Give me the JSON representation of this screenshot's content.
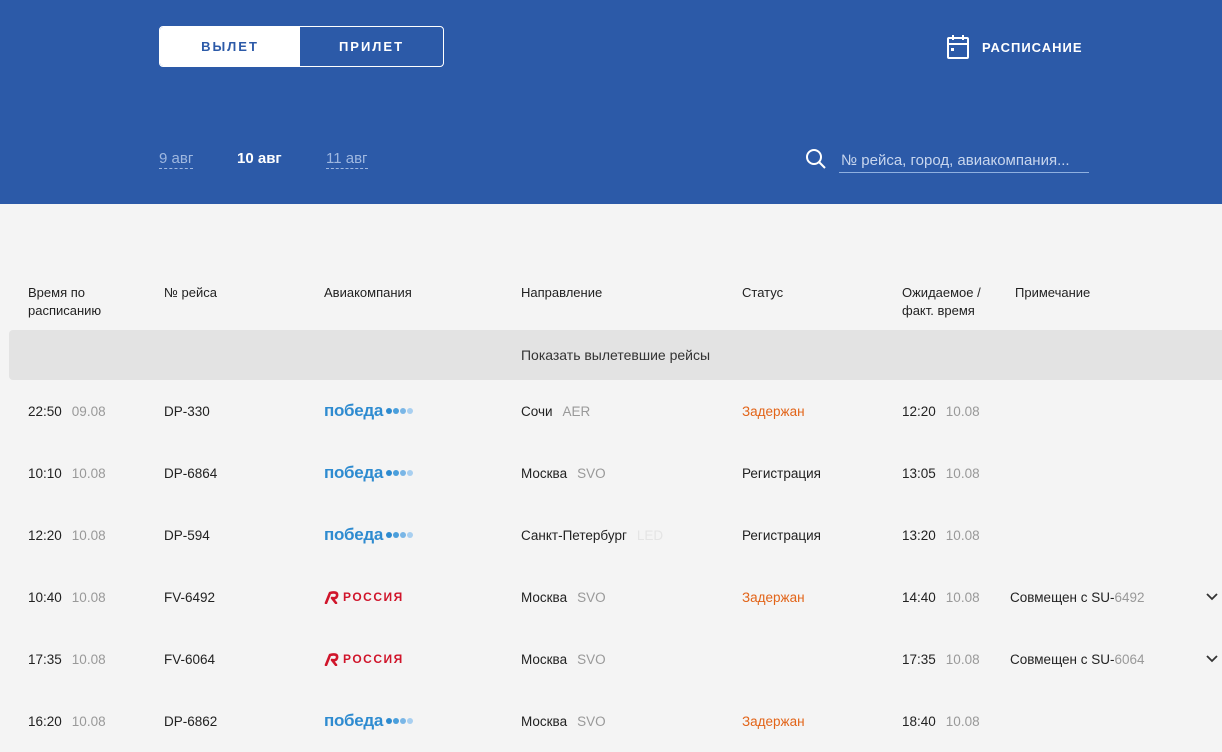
{
  "header": {
    "tabs": {
      "departure": "ВЫЛЕТ",
      "arrival": "ПРИЛЕТ"
    },
    "schedule_label": "РАСПИСАНИЕ",
    "dates": [
      "9 авг",
      "10 авг",
      "11 авг"
    ],
    "search_placeholder": "№ рейса, город, авиакомпания..."
  },
  "table": {
    "columns": {
      "time": "Время по расписанию",
      "flight": "№ рейса",
      "airline": "Авиакомпания",
      "direction": "Направление",
      "status": "Статус",
      "expected": "Ожидаемое / факт. время",
      "note": "Примечание"
    },
    "show_past": "Показать вылетевшие рейсы",
    "rows": [
      {
        "time": "22:50",
        "date": "09.08",
        "flight": "DP-330",
        "airline": "победа",
        "city": "Сочи",
        "code": "AER",
        "status": "Задержан",
        "exp_time": "12:20",
        "exp_date": "10.08",
        "note": "",
        "note_code": ""
      },
      {
        "time": "10:10",
        "date": "10.08",
        "flight": "DP-6864",
        "airline": "победа",
        "city": "Москва",
        "code": "SVO",
        "status": "Регистрация",
        "exp_time": "13:05",
        "exp_date": "10.08",
        "note": "",
        "note_code": ""
      },
      {
        "time": "12:20",
        "date": "10.08",
        "flight": "DP-594",
        "airline": "победа",
        "city": "Санкт-Петербург",
        "code": "LED",
        "status": "Регистрация",
        "exp_time": "13:20",
        "exp_date": "10.08",
        "note": "",
        "note_code": ""
      },
      {
        "time": "10:40",
        "date": "10.08",
        "flight": "FV-6492",
        "airline": "РОССИЯ",
        "city": "Москва",
        "code": "SVO",
        "status": "Задержан",
        "exp_time": "14:40",
        "exp_date": "10.08",
        "note": "Совмещен с SU-",
        "note_code": "6492"
      },
      {
        "time": "17:35",
        "date": "10.08",
        "flight": "FV-6064",
        "airline": "РОССИЯ",
        "city": "Москва",
        "code": "SVO",
        "status": "",
        "exp_time": "17:35",
        "exp_date": "10.08",
        "note": "Совмещен с SU-",
        "note_code": "6064"
      },
      {
        "time": "16:20",
        "date": "10.08",
        "flight": "DP-6862",
        "airline": "победа",
        "city": "Москва",
        "code": "SVO",
        "status": "Задержан",
        "exp_time": "18:40",
        "exp_date": "10.08",
        "note": "",
        "note_code": ""
      }
    ]
  },
  "colors": {
    "brand_blue": "#2c5aa8",
    "delayed": "#e26418",
    "pobeda": "#2e8bd0",
    "rossiya": "#d0152b"
  }
}
